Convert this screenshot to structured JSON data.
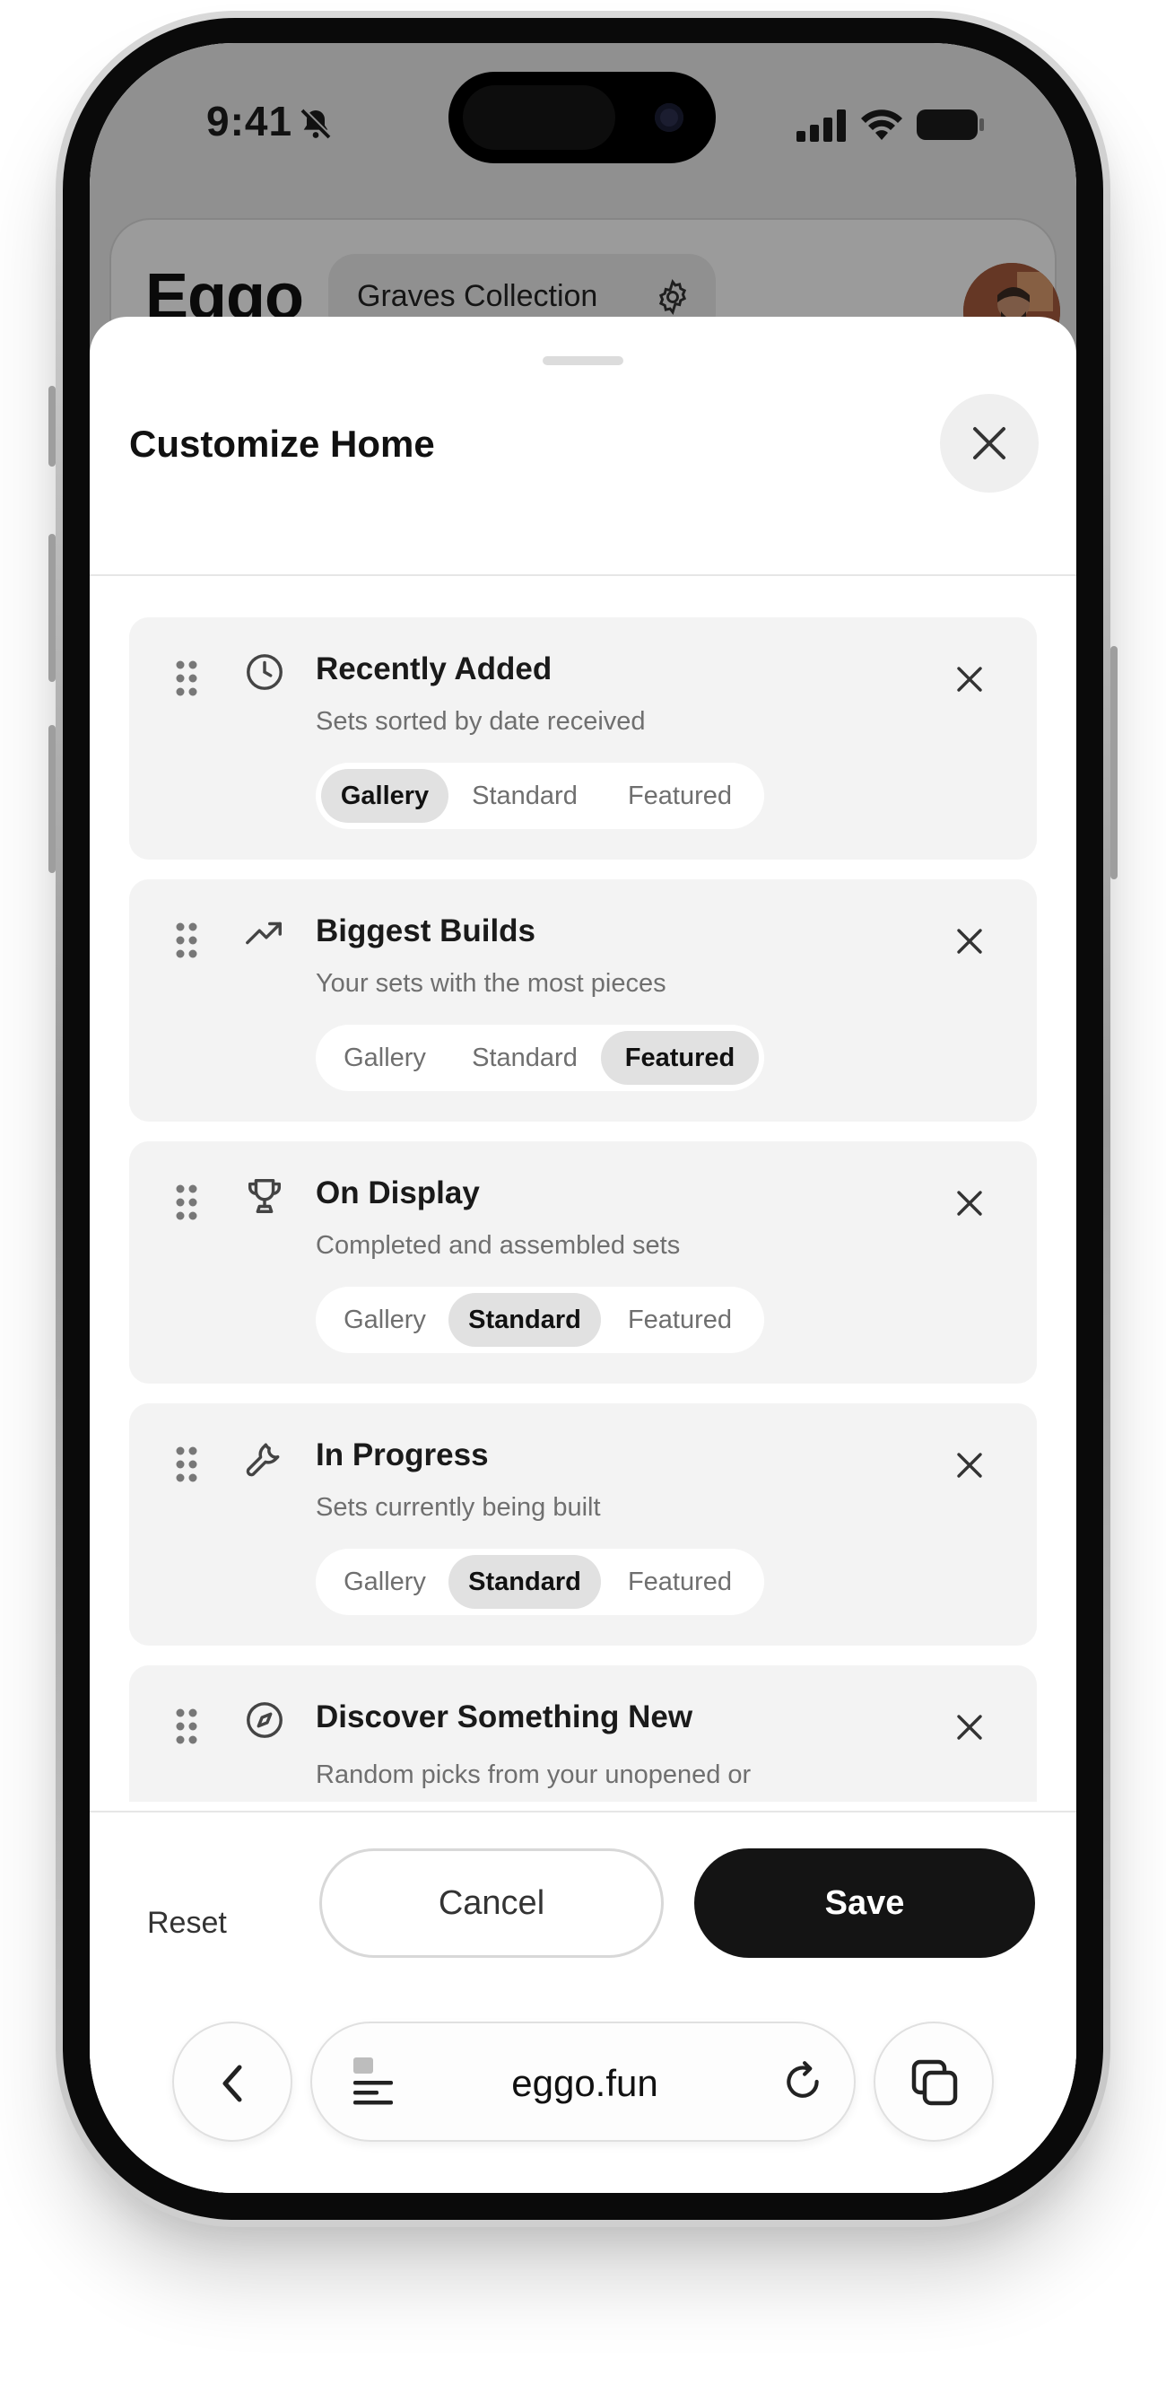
{
  "status_bar": {
    "time": "9:41"
  },
  "background_app": {
    "logo": "Eggo",
    "collection_label": "Graves Collection"
  },
  "sheet": {
    "title": "Customize Home",
    "sections": [
      {
        "title": "Recently Added",
        "description": "Sets sorted by date received",
        "icon": "clock-icon",
        "options": [
          "Gallery",
          "Standard",
          "Featured"
        ],
        "selected": "Gallery"
      },
      {
        "title": "Biggest Builds",
        "description": "Your sets with the most pieces",
        "icon": "trending-up-icon",
        "options": [
          "Gallery",
          "Standard",
          "Featured"
        ],
        "selected": "Featured"
      },
      {
        "title": "On Display",
        "description": "Completed and assembled sets",
        "icon": "trophy-icon",
        "options": [
          "Gallery",
          "Standard",
          "Featured"
        ],
        "selected": "Standard"
      },
      {
        "title": "In Progress",
        "description": "Sets currently being built",
        "icon": "wrench-icon",
        "options": [
          "Gallery",
          "Standard",
          "Featured"
        ],
        "selected": "Standard"
      },
      {
        "title": "Discover Something New",
        "description": "Random picks from your unopened or disassembled sets",
        "icon": "compass-icon"
      }
    ],
    "footer": {
      "reset_label": "Reset",
      "cancel_label": "Cancel",
      "save_label": "Save"
    }
  },
  "browser": {
    "url": "eggo.fun"
  },
  "colors": {
    "accent": "#141414",
    "card_bg": "#f3f3f3",
    "segment_active": "#e1e1e1"
  }
}
